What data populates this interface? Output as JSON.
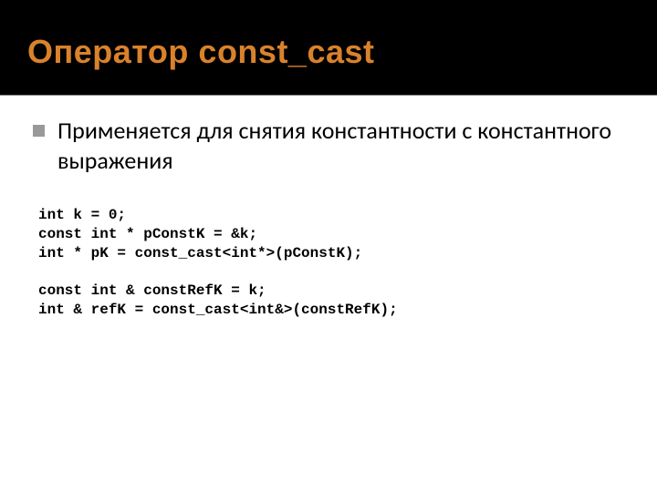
{
  "title": "Оператор const_cast",
  "bullet": "Применяется для снятия константности с константного выражения",
  "code": [
    "int k = 0;",
    "const int * pConstK = &k;",
    "int * pK = const_cast<int*>(pConstK);",
    "",
    "const int & constRefK = k;",
    "int & refK = const_cast<int&>(constRefK);"
  ]
}
